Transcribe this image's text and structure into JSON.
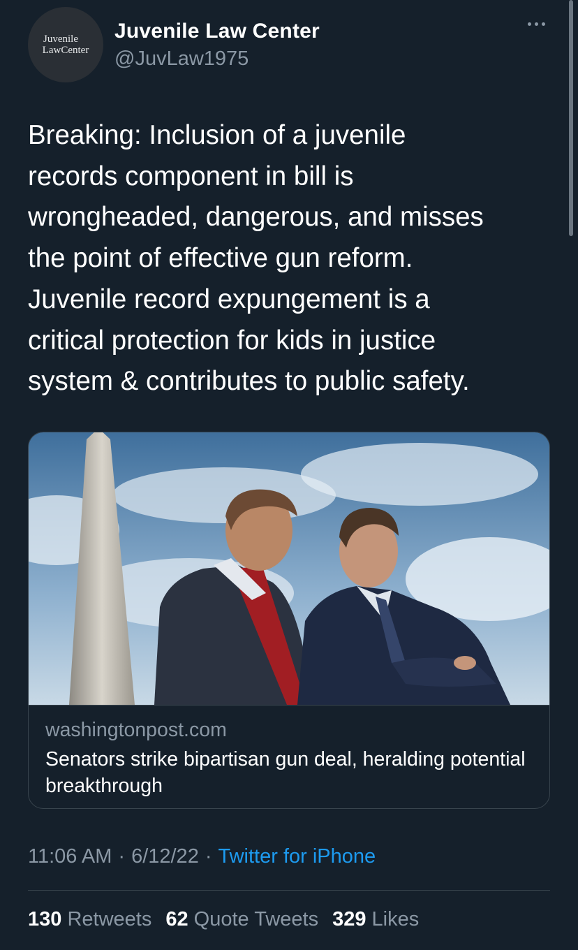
{
  "account": {
    "avatar_line1": "Juvenile",
    "avatar_line2": "LawCenter",
    "display_name": "Juvenile Law Center",
    "handle": "@JuvLaw1975"
  },
  "tweet": {
    "text": "Breaking: Inclusion of a juvenile\nrecords component in bill is\nwrongheaded, dangerous, and misses\nthe point of effective gun reform.\nJuvenile record expungement is a\ncritical protection for kids in justice\nsystem & contributes to public safety."
  },
  "link_card": {
    "domain": "washingtonpost.com",
    "title": "Senators strike bipartisan gun deal, heralding potential breakthrough"
  },
  "meta": {
    "time": "11:06 AM",
    "date": "6/12/22",
    "separator": "·",
    "source": "Twitter for iPhone"
  },
  "stats": {
    "retweets_count": "130",
    "retweets_label": "Retweets",
    "quotes_count": "62",
    "quotes_label": "Quote Tweets",
    "likes_count": "329",
    "likes_label": "Likes"
  },
  "colors": {
    "background": "#15202b",
    "accent": "#1d9bf0",
    "secondary_text": "#8b98a5",
    "border": "#38444d"
  },
  "icons": [
    "more-icon"
  ]
}
